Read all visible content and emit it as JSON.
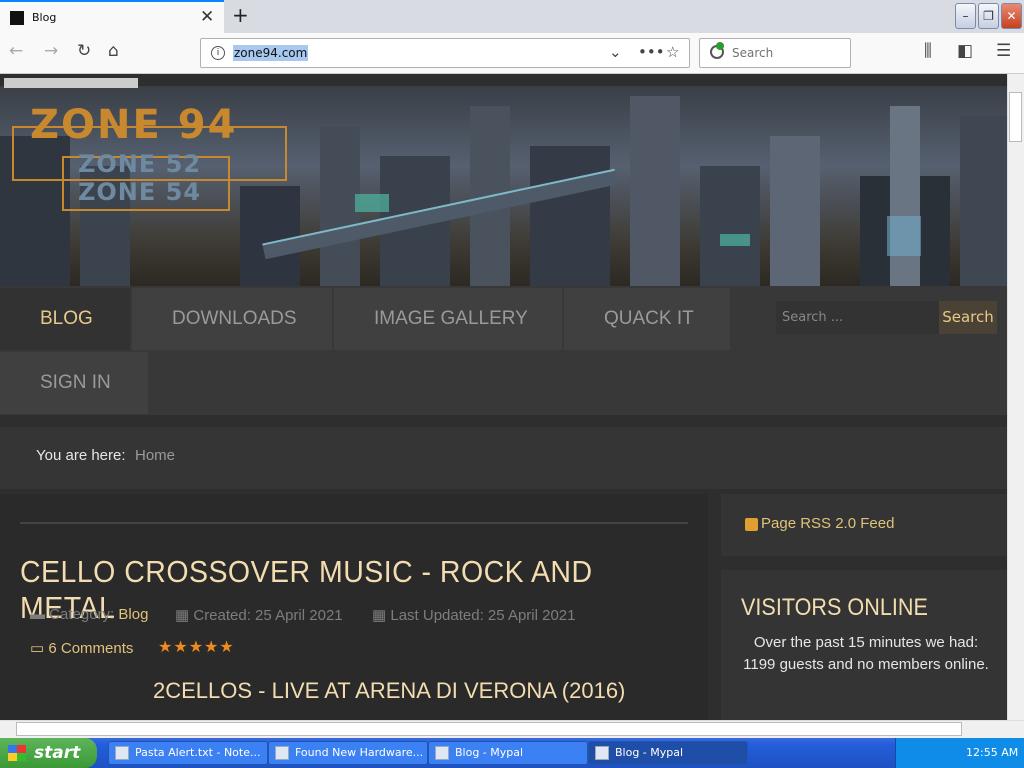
{
  "browser": {
    "tab_title": "Blog",
    "url": "zone94.com",
    "search_placeholder": "Search"
  },
  "banner": {
    "logo_main": "ZONE 94",
    "logo_sub1": "ZONE 52",
    "logo_sub2": "ZONE 54"
  },
  "menu": {
    "items": [
      "BLOG",
      "DOWNLOADS",
      "IMAGE GALLERY",
      "QUACK IT",
      "SIGN IN"
    ],
    "active": "BLOG",
    "search_placeholder": "Search ...",
    "search_button": "Search"
  },
  "breadcrumb": {
    "label": "You are here:",
    "current": "Home"
  },
  "article": {
    "title": "CELLO CROSSOVER MUSIC - ROCK AND METAL",
    "category_label": "Category:",
    "category": "Blog",
    "created": "Created: 25 April 2021",
    "updated": "Last Updated: 25 April 2021",
    "comments": "6 Comments",
    "rating": 5,
    "rating_stars": "★★★★★",
    "subtitle": "2CELLOS - LIVE AT ARENA DI VERONA (2016)"
  },
  "sidebar": {
    "rss": "Page RSS 2.0 Feed",
    "visitors_title": "VISITORS ONLINE",
    "visitors_text": "Over the past 15 minutes we had: 1199 guests and no members online."
  },
  "taskbar": {
    "start": "start",
    "items": [
      "Pasta Alert.txt - Note...",
      "Found New Hardware...",
      "Blog - Mypal",
      "Blog - Mypal"
    ],
    "clock": "12:55 AM"
  }
}
